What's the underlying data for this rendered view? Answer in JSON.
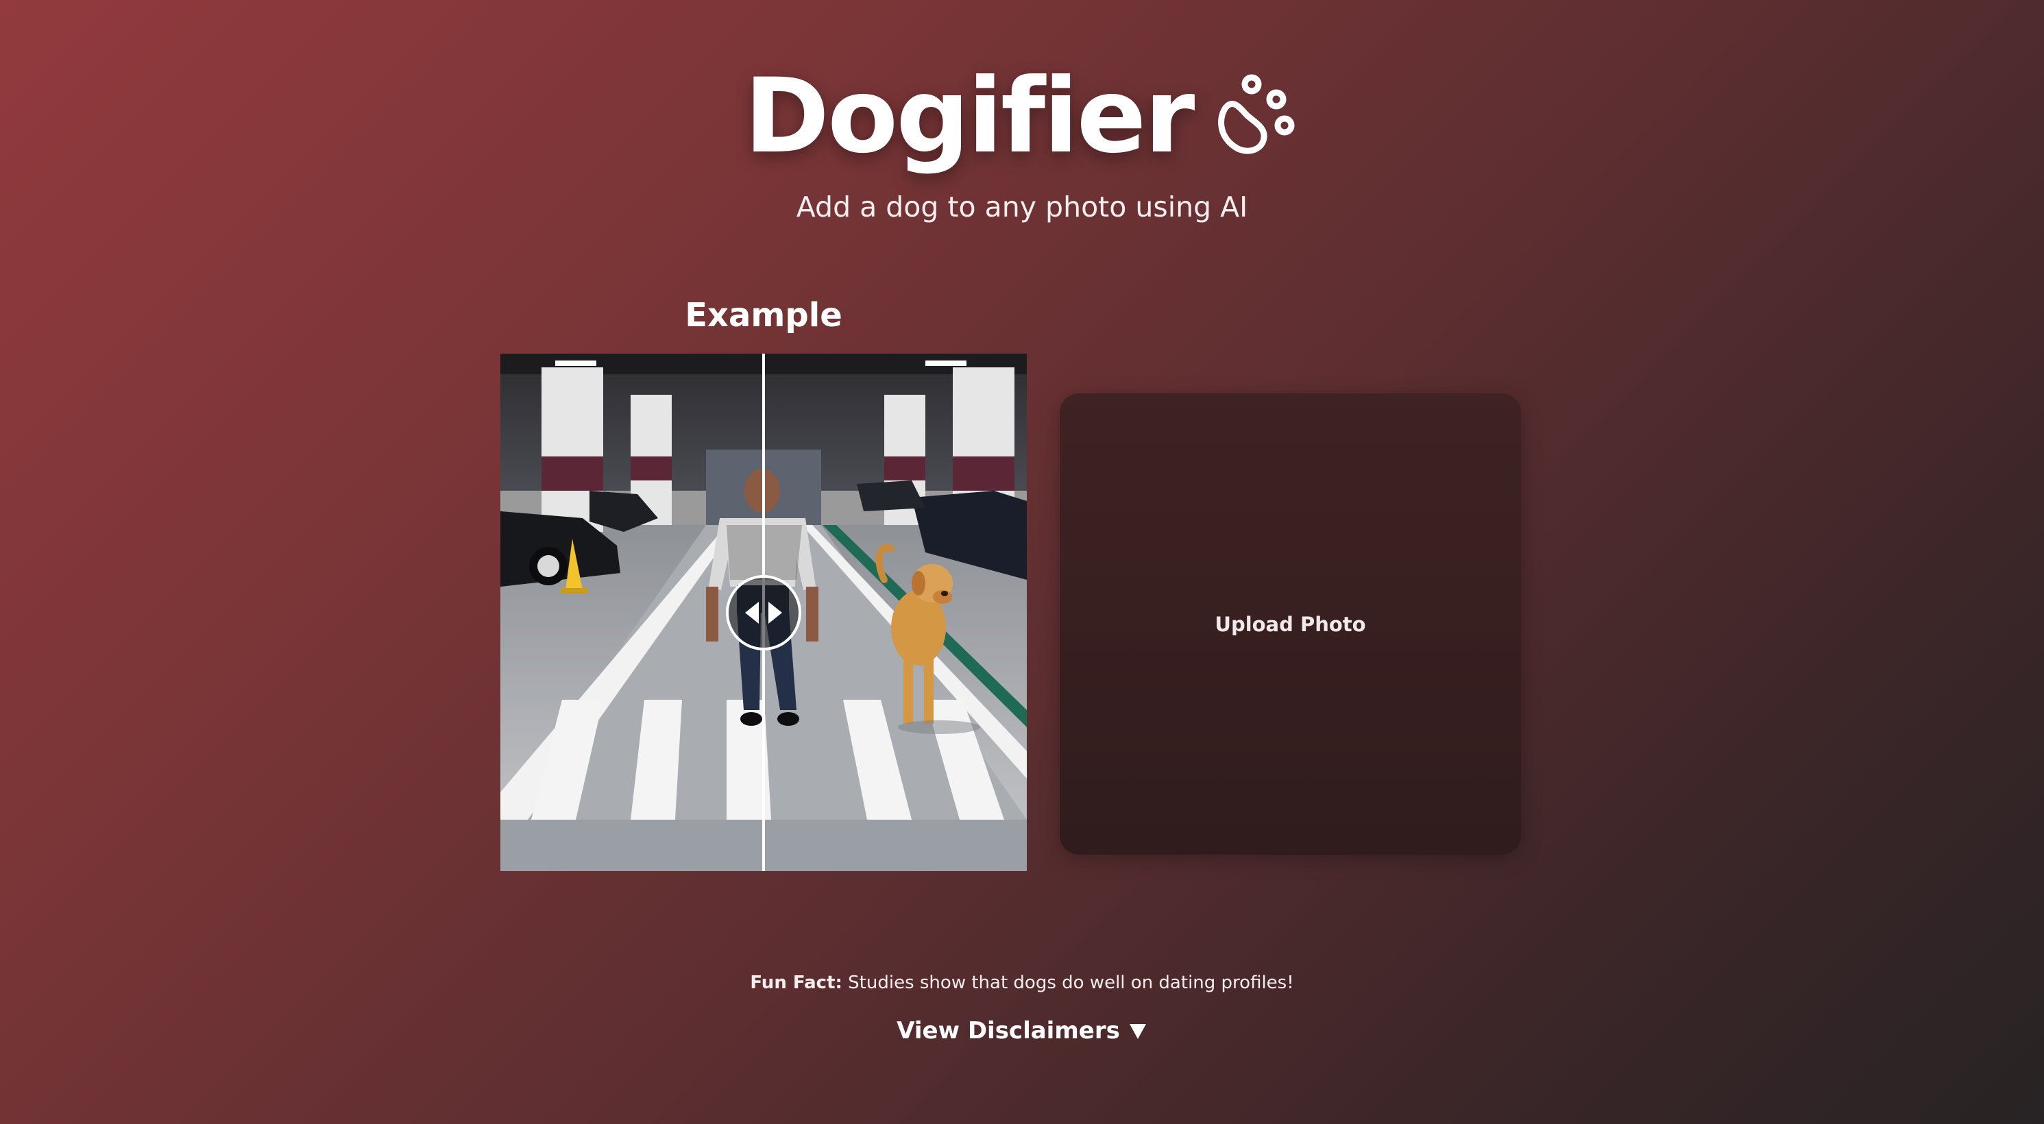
{
  "header": {
    "title": "Dogifier",
    "subtitle": "Add a dog to any photo using AI",
    "logo_icon": "paw-icon"
  },
  "example": {
    "heading": "Example",
    "slider_position": 0.5,
    "slider_icon": "left-right-arrows-icon"
  },
  "upload": {
    "label": "Upload Photo"
  },
  "footer": {
    "fun_fact_label": "Fun Fact:",
    "fun_fact_text": " Studies show that dogs do well on dating profiles!",
    "disclaimers_label": "View Disclaimers",
    "disclaimers_icon": "caret-down-icon"
  },
  "colors": {
    "background_start": "#923a3e",
    "background_end": "#272324",
    "upload_box": "#3a2021",
    "text": "#ffffff"
  }
}
